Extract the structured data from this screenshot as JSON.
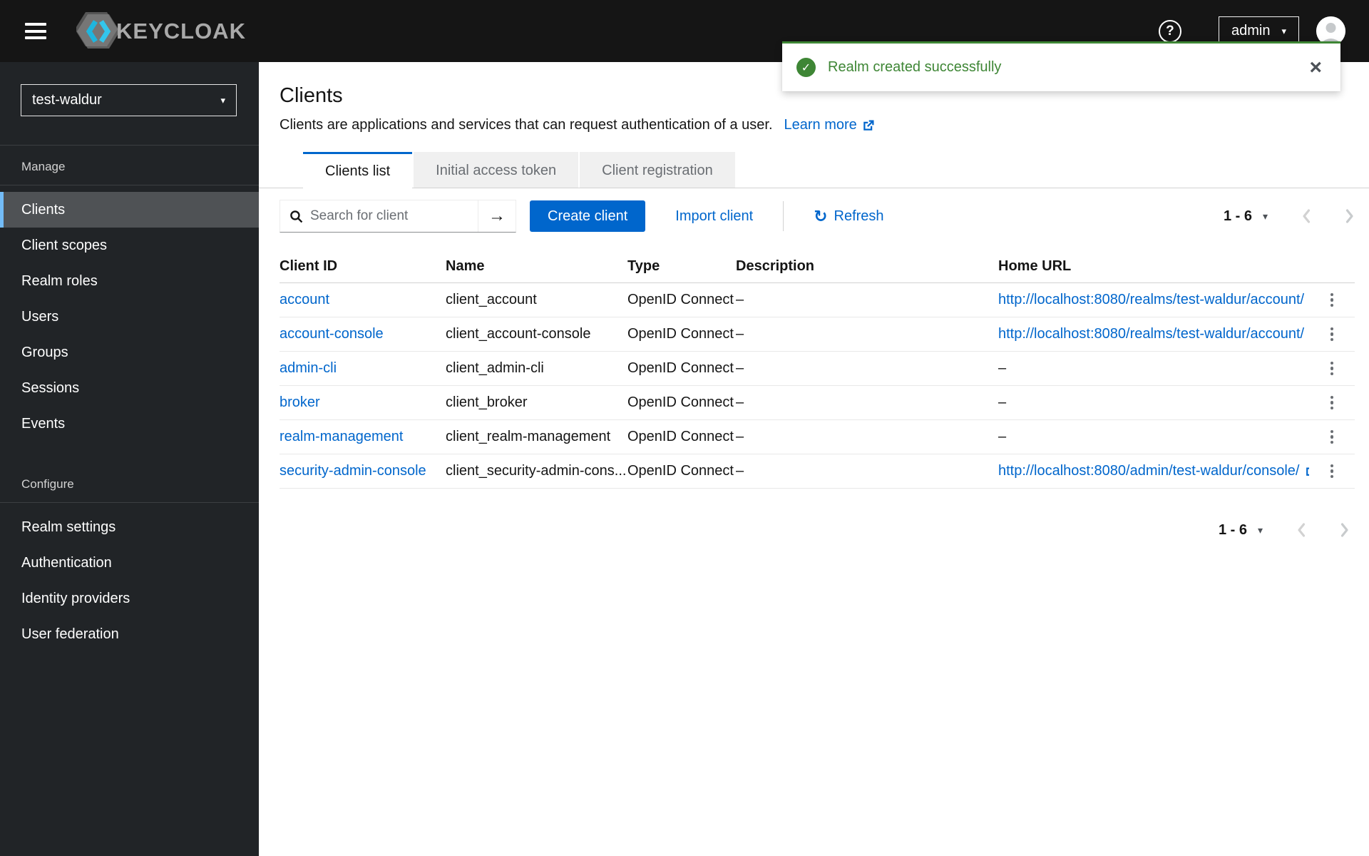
{
  "colors": {
    "accent": "#0066cc",
    "success": "#3e8635",
    "header_bg": "#151515",
    "sidebar_bg": "#212427",
    "nav_active_accent": "#73bcf7"
  },
  "icons": {
    "help": "?",
    "caret_down": "▾",
    "search_submit": "→",
    "refresh": "↻",
    "check": "✓",
    "close": "×"
  },
  "header": {
    "brand": "KEYCLOAK",
    "user": "admin"
  },
  "toast": {
    "message": "Realm created successfully"
  },
  "sidebar": {
    "realm_selector": {
      "value": "test-waldur"
    },
    "sections": [
      {
        "label": "Manage",
        "items": [
          {
            "label": "Clients",
            "active": true
          },
          {
            "label": "Client scopes"
          },
          {
            "label": "Realm roles"
          },
          {
            "label": "Users"
          },
          {
            "label": "Groups"
          },
          {
            "label": "Sessions"
          },
          {
            "label": "Events"
          }
        ]
      },
      {
        "label": "Configure",
        "items": [
          {
            "label": "Realm settings"
          },
          {
            "label": "Authentication"
          },
          {
            "label": "Identity providers"
          },
          {
            "label": "User federation"
          }
        ]
      }
    ]
  },
  "main": {
    "title": "Clients",
    "description": "Clients are applications and services that can request authentication of a user.",
    "learn_more": "Learn more",
    "tabs": [
      {
        "label": "Clients list",
        "active": true
      },
      {
        "label": "Initial access token"
      },
      {
        "label": "Client registration"
      }
    ],
    "toolbar": {
      "search_placeholder": "Search for client",
      "create_button": "Create client",
      "import_link": "Import client",
      "refresh_label": "Refresh",
      "pagination": {
        "range": "1 - 6"
      }
    },
    "table": {
      "columns": [
        "Client ID",
        "Name",
        "Type",
        "Description",
        "Home URL"
      ],
      "rows": [
        {
          "client_id": "account",
          "name": "client_account",
          "type": "OpenID Connect",
          "description": "–",
          "home_url": "http://localhost:8080/realms/test-waldur/account/"
        },
        {
          "client_id": "account-console",
          "name": "client_account-console",
          "type": "OpenID Connect",
          "description": "–",
          "home_url": "http://localhost:8080/realms/test-waldur/account/"
        },
        {
          "client_id": "admin-cli",
          "name": "client_admin-cli",
          "type": "OpenID Connect",
          "description": "–",
          "home_url": "–"
        },
        {
          "client_id": "broker",
          "name": "client_broker",
          "type": "OpenID Connect",
          "description": "–",
          "home_url": "–"
        },
        {
          "client_id": "realm-management",
          "name": "client_realm-management",
          "type": "OpenID Connect",
          "description": "–",
          "home_url": "–"
        },
        {
          "client_id": "security-admin-console",
          "name": "client_security-admin-cons...",
          "type": "OpenID Connect",
          "description": "–",
          "home_url": "http://localhost:8080/admin/test-waldur/console/"
        }
      ]
    },
    "pagination_bottom": {
      "range": "1 - 6"
    }
  }
}
